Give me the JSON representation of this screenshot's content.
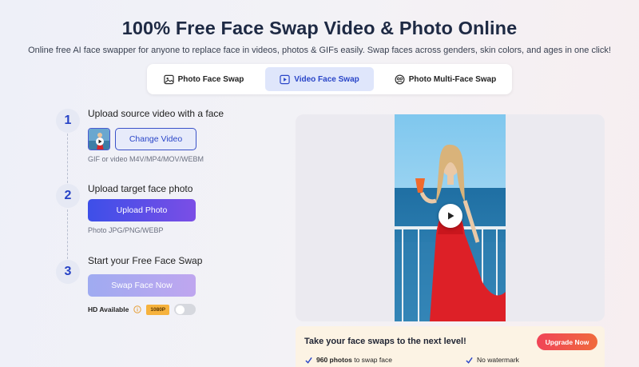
{
  "page": {
    "title": "100% Free Face Swap Video & Photo Online",
    "subtitle": "Online free AI face swapper for anyone to replace face in videos, photos & GIFs easily. Swap faces across genders, skin colors, and ages in one click!"
  },
  "tabs": [
    {
      "label": "Photo Face Swap",
      "icon": "image-icon",
      "active": false
    },
    {
      "label": "Video Face Swap",
      "icon": "video-icon",
      "active": true
    },
    {
      "label": "Photo Multi-Face Swap",
      "icon": "faces-icon",
      "active": false
    }
  ],
  "steps": [
    {
      "number": "1",
      "title": "Upload source video with a face",
      "button": "Change Video",
      "hint": "GIF or video M4V/MP4/MOV/WEBM"
    },
    {
      "number": "2",
      "title": "Upload target face photo",
      "button": "Upload Photo",
      "hint": "Photo JPG/PNG/WEBP"
    },
    {
      "number": "3",
      "title": "Start your Free Face Swap",
      "button": "Swap Face Now"
    }
  ],
  "hd": {
    "label": "HD Available",
    "badge": "1080P",
    "enabled": false
  },
  "upgrade": {
    "title": "Take your face swaps to the next level!",
    "button": "Upgrade Now",
    "feature1_bold": "960 photos",
    "feature1_rest": " to swap face",
    "feature2": "No watermark"
  },
  "colors": {
    "accent": "#2a46c8",
    "upgrade": "#f04457",
    "badge": "#f6b23d"
  }
}
